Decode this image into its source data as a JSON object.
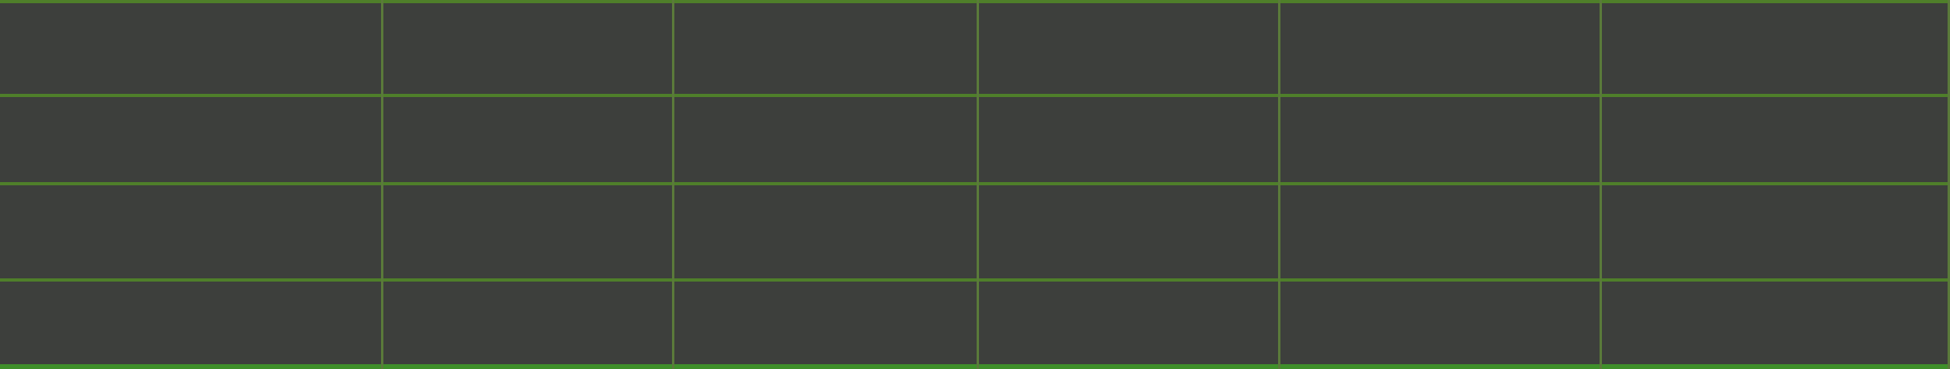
{
  "table": {
    "rows": 4,
    "columns": 6,
    "cells": [
      [
        "",
        "",
        "",
        "",
        "",
        ""
      ],
      [
        "",
        "",
        "",
        "",
        "",
        ""
      ],
      [
        "",
        "",
        "",
        "",
        "",
        ""
      ],
      [
        "",
        "",
        "",
        "",
        "",
        ""
      ]
    ]
  },
  "colors": {
    "background": "#3d3f3c",
    "grid_line": "#4f7f2a",
    "grid_line_vertical": "#5a7a3a",
    "border_bottom": "#3f8f2a"
  }
}
